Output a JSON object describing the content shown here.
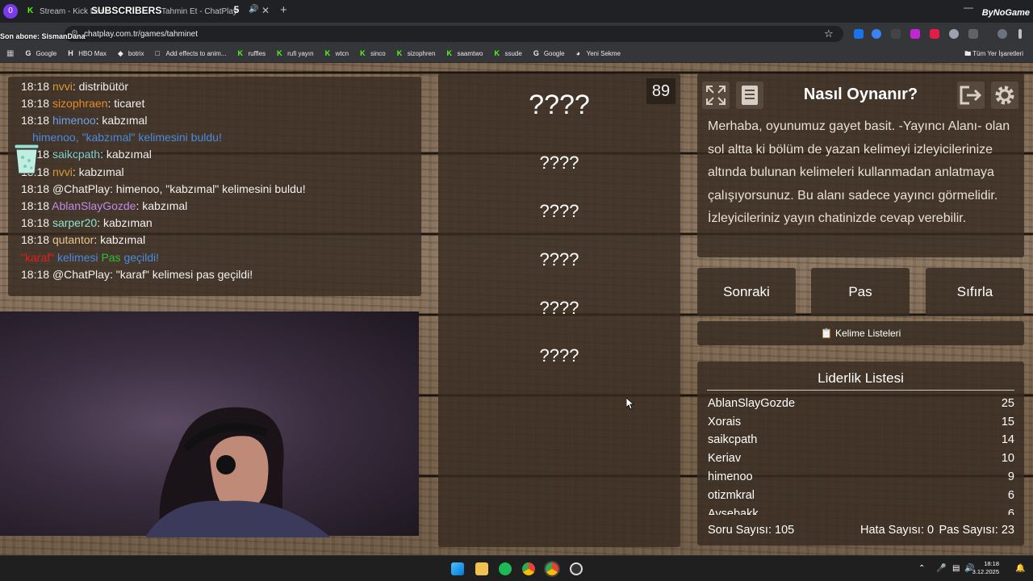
{
  "browser": {
    "badge": "0",
    "tabs": [
      {
        "label": "Stream - Kick Dash"
      },
      {
        "label": "Tahmin Et - ChatPlay"
      }
    ],
    "overlay_subscribers": "SUBSCRIBERS",
    "tab_count": "5",
    "overlay_last_sub": "Son abone: SismanDana",
    "url": "chatplay.com.tr/games/tahminet",
    "overlay_brand": "ByNoGame",
    "bookmarks": [
      "Google",
      "HBO Max",
      "botrix",
      "Add effects to anim...",
      "ruffles",
      "rufi yayın",
      "wtcn",
      "sinco",
      "sizophren",
      "saamtwo",
      "ssude",
      "Google",
      "Yeni Sekme"
    ],
    "all_bookmarks": "Tüm Yer İşaretleri"
  },
  "chat": {
    "messages": [
      {
        "time": "18:18",
        "user": "nvvi",
        "user_color": "#d89b3a",
        "text": "distribütör"
      },
      {
        "time": "18:18",
        "user": "sizophraen",
        "user_color": "#e58b2b",
        "text": "ticaret"
      },
      {
        "time": "18:18",
        "user": "himenoo",
        "user_color": "#6aa0e8",
        "text": "kabzımal"
      },
      {
        "time": "",
        "user": "himenoo, \"kabzımal\" kelimesini buldu!",
        "user_color": "#4a8ae0",
        "text": ""
      },
      {
        "time": "18:18",
        "user": "saikcpath",
        "user_color": "#7fd3d3",
        "text": "kabzımal"
      },
      {
        "time": "18:18",
        "user": "nvvi",
        "user_color": "#d89b3a",
        "text": "kabzımal"
      },
      {
        "time": "18:18",
        "user": "@ChatPlay",
        "user_color": "#f1f1f1",
        "text": "himenoo, \"kabzımal\" kelimesini buldu!"
      },
      {
        "time": "18:18",
        "user": "AblanSlayGozde",
        "user_color": "#c08be8",
        "text": "kabzımal"
      },
      {
        "time": "18:18",
        "user": "sarper20",
        "user_color": "#8fe3d0",
        "text": "kabzıman"
      },
      {
        "time": "18:18",
        "user": "qutantor",
        "user_color": "#e8c48f",
        "text": "kabzımal"
      },
      {
        "time": "",
        "user": "\"karaf\"",
        "user_color": "#e02020",
        "text": ""
      },
      {
        "time": "18:18",
        "user": "@ChatPlay",
        "user_color": "#f1f1f1",
        "text": "\"karaf\" kelimesi pas geçildi!"
      }
    ],
    "pass_notice_mid": "kelimesi",
    "pass_notice_pas": "Pas",
    "pass_notice_end": "geçildi!"
  },
  "game": {
    "counter": "89",
    "main_word": "????",
    "forbidden_words": [
      "????",
      "????",
      "????",
      "????",
      "????"
    ]
  },
  "howto": {
    "title": "Nasıl Oynanır?",
    "text": "Merhaba, oyunumuz gayet basit. -Yayıncı Alanı- olan sol altta ki bölüm de yazan kelimeyi izleyicilerinize altında bulunan kelimeleri kullanmadan anlatmaya çalışıyorsunuz. Bu alanı sadece yayıncı görmelidir. İzleyicileriniz yayın chatinizde cevap verebilir."
  },
  "controls": {
    "next": "Sonraki",
    "pass": "Pas",
    "reset": "Sıfırla",
    "word_lists": "Kelime Listeleri"
  },
  "leaderboard": {
    "title": "Liderlik Listesi",
    "rows": [
      {
        "name": "AblanSlayGozde",
        "score": "25"
      },
      {
        "name": "Xorais",
        "score": "15"
      },
      {
        "name": "saikcpath",
        "score": "14"
      },
      {
        "name": "Keriav",
        "score": "10"
      },
      {
        "name": "himenoo",
        "score": "9"
      },
      {
        "name": "otizmkral",
        "score": "6"
      },
      {
        "name": "Aysebakk",
        "score": "6"
      }
    ],
    "questions": "Soru Sayısı: 105",
    "errors": "Hata Sayısı: 0",
    "passes": "Pas Sayısı: 23"
  },
  "taskbar": {
    "time": "18:18",
    "date": "3.12.2025"
  }
}
